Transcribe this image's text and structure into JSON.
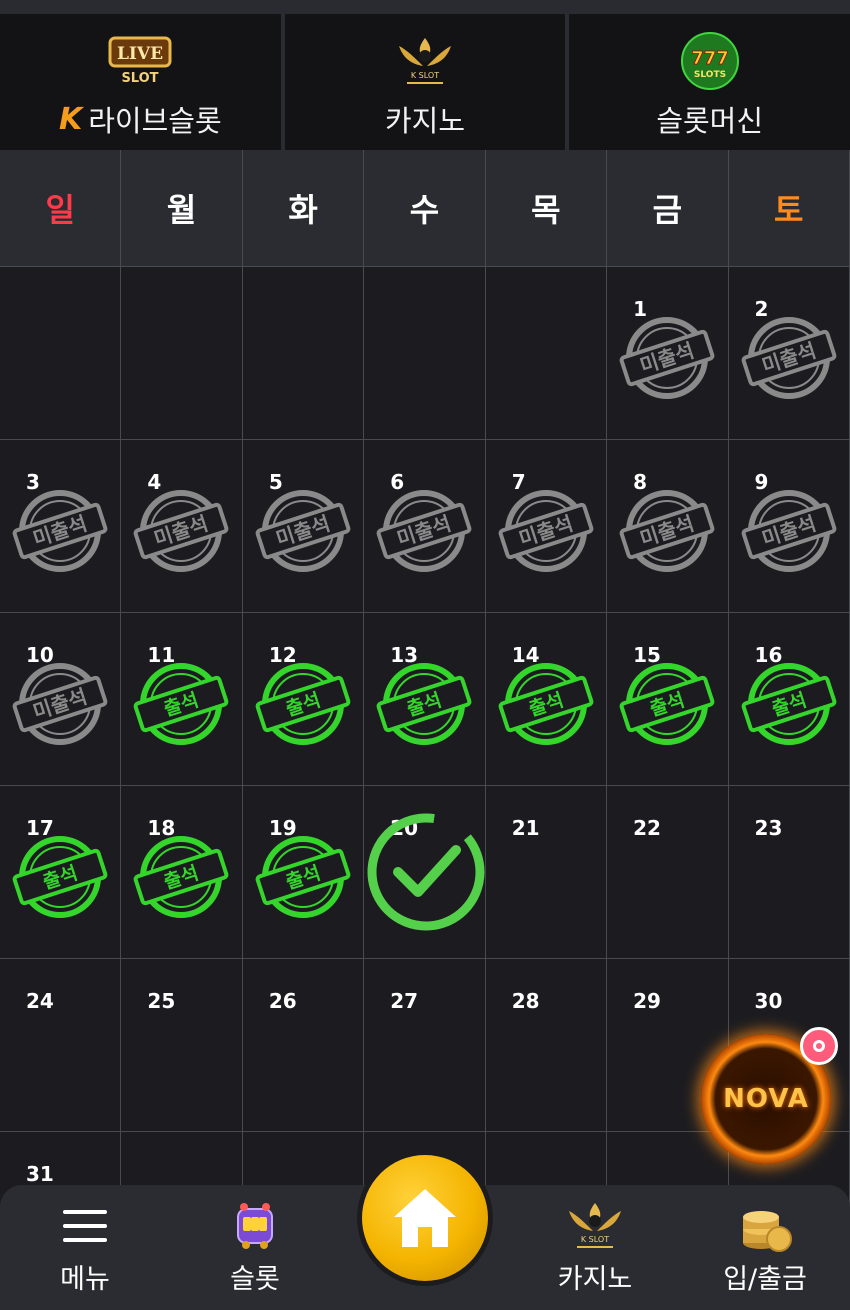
{
  "categories": [
    {
      "label": "라이브슬롯",
      "logo_text": "LIVE",
      "logo_sub": "SLOT",
      "icon": "live-slot-logo"
    },
    {
      "label": "카지노",
      "logo_text": "K SLOT",
      "icon": "k-slot-logo"
    },
    {
      "label": "슬롯머신",
      "logo_text": "777",
      "logo_sub": "SLOTS",
      "icon": "777-slots-logo"
    }
  ],
  "calendar": {
    "weekdays": [
      "일",
      "월",
      "화",
      "수",
      "목",
      "금",
      "토"
    ],
    "stamp_labels": {
      "absent": "미출석",
      "present": "출석"
    },
    "colors": {
      "sunday": "#ff3b4a",
      "saturday": "#ff8a1e",
      "present": "#35d62c",
      "absent": "#8a8a8a",
      "today_check": "#55d04a"
    },
    "days": [
      {
        "day": "",
        "status": ""
      },
      {
        "day": "",
        "status": ""
      },
      {
        "day": "",
        "status": ""
      },
      {
        "day": "",
        "status": ""
      },
      {
        "day": "",
        "status": ""
      },
      {
        "day": "1",
        "status": "absent"
      },
      {
        "day": "2",
        "status": "absent"
      },
      {
        "day": "3",
        "status": "absent"
      },
      {
        "day": "4",
        "status": "absent"
      },
      {
        "day": "5",
        "status": "absent"
      },
      {
        "day": "6",
        "status": "absent"
      },
      {
        "day": "7",
        "status": "absent"
      },
      {
        "day": "8",
        "status": "absent"
      },
      {
        "day": "9",
        "status": "absent"
      },
      {
        "day": "10",
        "status": "absent"
      },
      {
        "day": "11",
        "status": "present"
      },
      {
        "day": "12",
        "status": "present"
      },
      {
        "day": "13",
        "status": "present"
      },
      {
        "day": "14",
        "status": "present"
      },
      {
        "day": "15",
        "status": "present"
      },
      {
        "day": "16",
        "status": "present"
      },
      {
        "day": "17",
        "status": "present"
      },
      {
        "day": "18",
        "status": "present"
      },
      {
        "day": "19",
        "status": "present"
      },
      {
        "day": "20",
        "status": "today"
      },
      {
        "day": "21",
        "status": ""
      },
      {
        "day": "22",
        "status": ""
      },
      {
        "day": "23",
        "status": ""
      },
      {
        "day": "24",
        "status": ""
      },
      {
        "day": "25",
        "status": ""
      },
      {
        "day": "26",
        "status": ""
      },
      {
        "day": "27",
        "status": ""
      },
      {
        "day": "28",
        "status": ""
      },
      {
        "day": "29",
        "status": ""
      },
      {
        "day": "30",
        "status": ""
      },
      {
        "day": "31",
        "status": ""
      },
      {
        "day": "",
        "status": ""
      },
      {
        "day": "",
        "status": ""
      },
      {
        "day": "",
        "status": ""
      },
      {
        "day": "",
        "status": ""
      },
      {
        "day": "",
        "status": ""
      },
      {
        "day": "",
        "status": ""
      }
    ]
  },
  "nova": {
    "label": "NOVA"
  },
  "bottom_nav": {
    "menu": "메뉴",
    "slot": "슬롯",
    "casino": "카지노",
    "casino_logo": "K SLOT",
    "deposit": "입/출금"
  }
}
